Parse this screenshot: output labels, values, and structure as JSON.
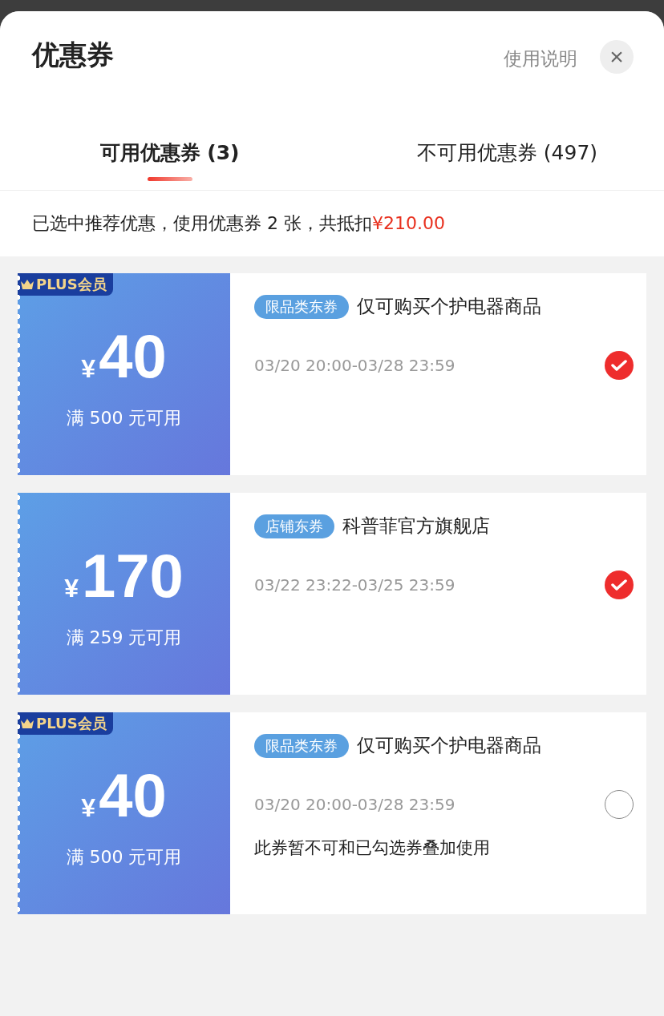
{
  "sheet": {
    "title": "优惠券",
    "help_link": "使用说明",
    "close": "×"
  },
  "tabs": [
    {
      "label": "可用优惠券 (3)",
      "selected": true
    },
    {
      "label": "不可用优惠券 (497)",
      "selected": false
    }
  ],
  "summary": {
    "text": "已选中推荐优惠，使用优惠券 2 张，共抵扣",
    "amount": "¥210.00"
  },
  "coupons": [
    {
      "badge": "PLUS会员",
      "currency": "¥",
      "amount": "40",
      "condition": "满 500 元可用",
      "tag": "限品类东券",
      "scope": "仅可购买个护电器商品",
      "validity": "03/20 20:00-03/28 23:59",
      "selected": true
    },
    {
      "currency": "¥",
      "amount": "170",
      "condition": "满 259 元可用",
      "tag": "店铺东券",
      "scope": "科普菲官方旗舰店",
      "validity": "03/22 23:22-03/25 23:59",
      "selected": true
    },
    {
      "badge": "PLUS会员",
      "currency": "¥",
      "amount": "40",
      "condition": "满 500 元可用",
      "tag": "限品类东券",
      "scope": "仅可购买个护电器商品",
      "validity": "03/20 20:00-03/28 23:59",
      "note": "此券暂不可和已勾选券叠加使用",
      "selected": false
    }
  ]
}
